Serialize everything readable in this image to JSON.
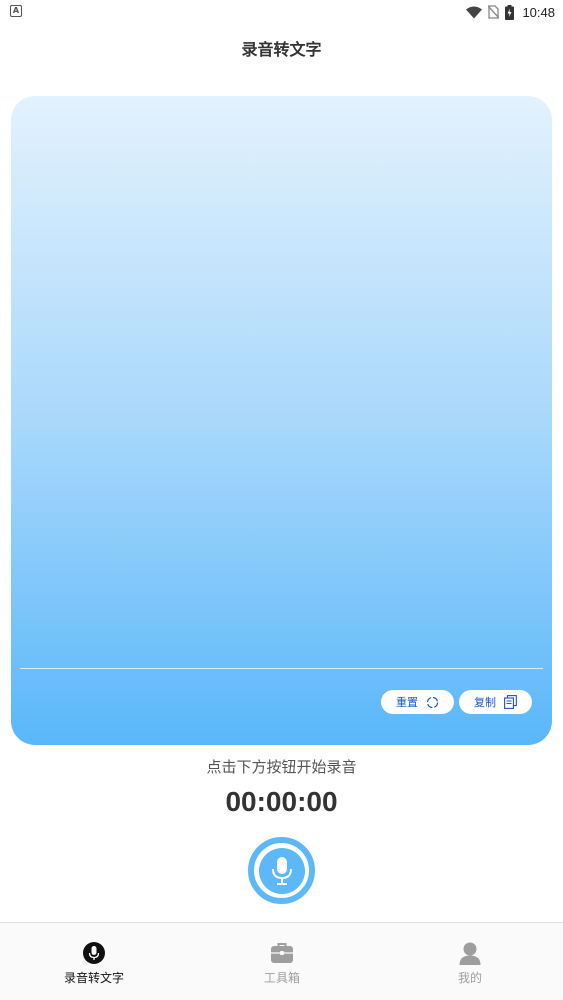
{
  "status_bar": {
    "app_icon_letter": "A",
    "time": "10:48"
  },
  "header": {
    "title": "录音转文字"
  },
  "card": {
    "reset_label": "重置",
    "copy_label": "复制",
    "gradient_top": "#e3f2fd",
    "gradient_bottom": "#5ab7fa"
  },
  "hint": "点击下方按钮开始录音",
  "timer": "00:00:00",
  "colors": {
    "accent": "#5cb8f7",
    "button_text": "#1a56c4"
  },
  "nav": {
    "items": [
      {
        "label": "录音转文字",
        "icon": "microphone-icon",
        "active": true
      },
      {
        "label": "工具箱",
        "icon": "toolbox-icon",
        "active": false
      },
      {
        "label": "我的",
        "icon": "person-icon",
        "active": false
      }
    ]
  }
}
